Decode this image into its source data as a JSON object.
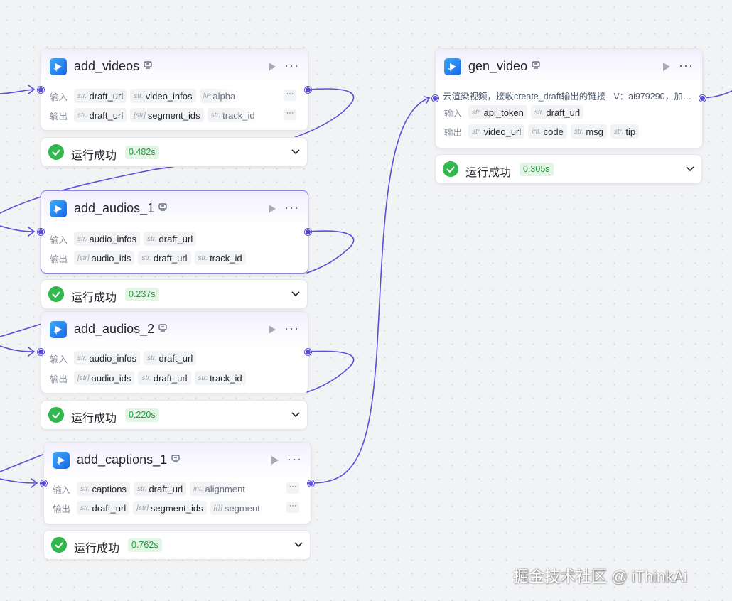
{
  "colors": {
    "edge": "#5b4fd6",
    "success": "#32b84e",
    "badge_bg": "#e3f6e6",
    "badge_text": "#1f9a3c",
    "icon_from": "#3fa9f5",
    "icon_to": "#1667e8"
  },
  "labels": {
    "input": "输入",
    "output": "输出"
  },
  "nodes": {
    "add_videos": {
      "title": "add_videos",
      "inputs": [
        {
          "type": "str.",
          "name": "draft_url"
        },
        {
          "type": "str.",
          "name": "video_infos"
        },
        {
          "type": "Nº",
          "name": "alpha"
        }
      ],
      "outputs": [
        {
          "type": "str.",
          "name": "draft_url"
        },
        {
          "type": "[str]",
          "name": "segment_ids"
        },
        {
          "type": "str.",
          "name": "track_id"
        }
      ],
      "status": {
        "text": "运行成功",
        "time": "0.482s"
      }
    },
    "add_audios_1": {
      "title": "add_audios_1",
      "inputs": [
        {
          "type": "str.",
          "name": "audio_infos"
        },
        {
          "type": "str.",
          "name": "draft_url"
        }
      ],
      "outputs": [
        {
          "type": "[str]",
          "name": "audio_ids"
        },
        {
          "type": "str.",
          "name": "draft_url"
        },
        {
          "type": "str.",
          "name": "track_id"
        }
      ],
      "status": {
        "text": "运行成功",
        "time": "0.237s"
      }
    },
    "add_audios_2": {
      "title": "add_audios_2",
      "inputs": [
        {
          "type": "str.",
          "name": "audio_infos"
        },
        {
          "type": "str.",
          "name": "draft_url"
        }
      ],
      "outputs": [
        {
          "type": "[str]",
          "name": "audio_ids"
        },
        {
          "type": "str.",
          "name": "draft_url"
        },
        {
          "type": "str.",
          "name": "track_id"
        }
      ],
      "status": {
        "text": "运行成功",
        "time": "0.220s"
      }
    },
    "add_captions_1": {
      "title": "add_captions_1",
      "inputs": [
        {
          "type": "str.",
          "name": "captions"
        },
        {
          "type": "str.",
          "name": "draft_url"
        },
        {
          "type": "int.",
          "name": "alignment"
        }
      ],
      "outputs": [
        {
          "type": "str.",
          "name": "draft_url"
        },
        {
          "type": "[str]",
          "name": "segment_ids"
        },
        {
          "type": "[{}]",
          "name": "segment"
        }
      ],
      "status": {
        "text": "运行成功",
        "time": "0.762s"
      }
    },
    "gen_video": {
      "title": "gen_video",
      "description": "云渲染视频，接收create_draft输出的链接 - V：ai979290，加…",
      "inputs": [
        {
          "type": "str.",
          "name": "api_token"
        },
        {
          "type": "str.",
          "name": "draft_url"
        }
      ],
      "outputs": [
        {
          "type": "str.",
          "name": "video_url"
        },
        {
          "type": "int.",
          "name": "code"
        },
        {
          "type": "str.",
          "name": "msg"
        },
        {
          "type": "str.",
          "name": "tip"
        }
      ],
      "status": {
        "text": "运行成功",
        "time": "0.305s"
      }
    }
  },
  "watermark": "掘金技术社区 @ iThinkAi"
}
